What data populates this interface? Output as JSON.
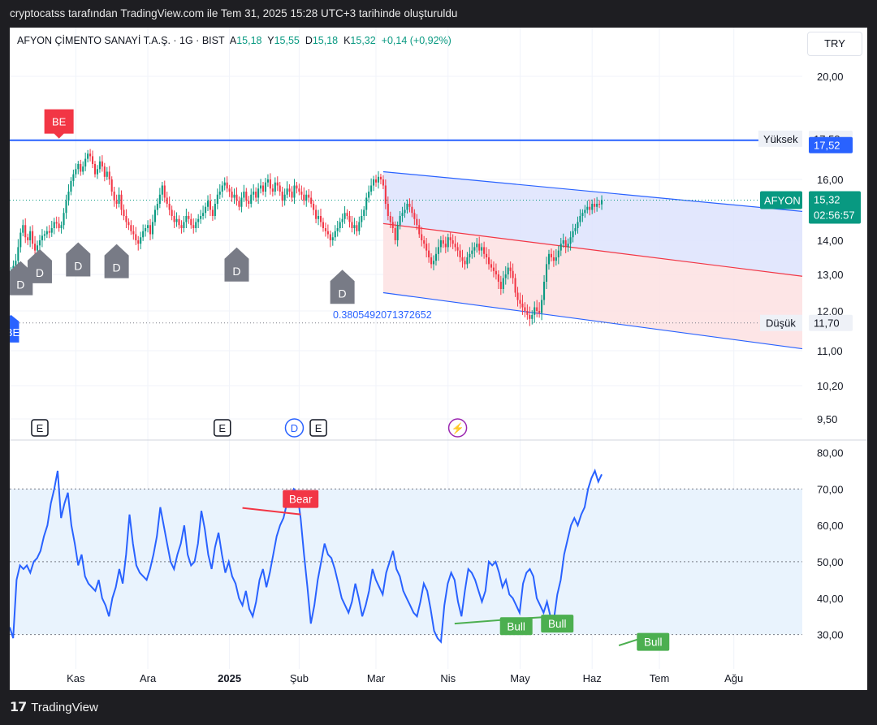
{
  "topbar": {
    "text": "cryptocatss tarafından TradingView.com ile Tem 31, 2025 15:28 UTC+3 tarihinde oluşturuldu"
  },
  "header": {
    "symbol": "AFYON ÇİMENTO SANAYİ T.A.Ş. · 1G · BIST",
    "open_label": "A",
    "open": "15,18",
    "high_label": "Y",
    "high": "15,55",
    "low_label": "D",
    "low": "15,18",
    "close_label": "K",
    "close": "15,32",
    "change": "+0,14 (+0,92%)"
  },
  "currency": "TRY",
  "footer": {
    "brand": "TradingView"
  },
  "colors": {
    "up": "#089981",
    "down": "#f23645",
    "channel_line": "#2962ff",
    "channel_upper_fill": "#dde3fd",
    "channel_lower_fill": "#fde0e2",
    "rsi_line": "#2962ff",
    "rsi_band_fill": "#e9f3fd",
    "bear": "#f23645",
    "bull": "#4caf50",
    "price_label": "#089981",
    "high_line": "#2962ff"
  },
  "chart_data": [
    {
      "type": "candlestick",
      "name": "price",
      "symbol_label": "AFYON",
      "ylim": [
        9.4,
        20.5
      ],
      "y_ticks": [
        "20,00",
        "16,00",
        "14,00",
        "13,00",
        "12,00",
        "11,00",
        "10,20",
        "9,50"
      ],
      "y_tick_values": [
        20,
        16,
        14,
        13,
        12,
        11,
        10.2,
        9.5
      ],
      "x_ticks": [
        "Kas",
        "Ara",
        "2025",
        "Şub",
        "Mar",
        "Nis",
        "May",
        "Haz",
        "Tem",
        "Ağu"
      ],
      "x_tick_index": [
        27,
        57,
        91,
        120,
        152,
        182,
        212,
        242,
        270,
        301
      ],
      "last_price": "15,32",
      "countdown": "02:56:57",
      "high_label": "Yüksek",
      "high_value": "17,58",
      "low_label": "Düşük",
      "low_value": "11,70",
      "horizontal_line": {
        "value": 17.52,
        "label": "17,52"
      },
      "channel_annotation": "0.3805492071372652",
      "channel": {
        "start_index": 155,
        "end_index": 330,
        "upper": [
          16.3,
          14.95
        ],
        "mid": [
          14.55,
          12.95
        ],
        "lower": [
          12.5,
          11.05
        ]
      },
      "closes": [
        13.1,
        13.25,
        13.4,
        13.8,
        14.25,
        14.5,
        14.1,
        14.0,
        14.3,
        13.9,
        13.7,
        13.85,
        14.0,
        14.15,
        14.2,
        14.3,
        14.25,
        14.4,
        14.6,
        14.55,
        14.4,
        14.5,
        14.9,
        15.3,
        15.6,
        15.95,
        16.2,
        16.4,
        16.6,
        16.3,
        16.5,
        16.8,
        17.0,
        16.9,
        16.6,
        16.2,
        16.4,
        16.7,
        16.5,
        16.1,
        16.3,
        16.0,
        15.6,
        15.3,
        15.2,
        15.5,
        15.0,
        14.8,
        14.6,
        14.5,
        14.3,
        14.2,
        14.0,
        13.9,
        14.1,
        14.3,
        14.4,
        14.5,
        14.2,
        14.6,
        15.0,
        15.2,
        15.5,
        15.8,
        15.4,
        15.2,
        15.0,
        14.8,
        14.6,
        14.7,
        14.5,
        14.4,
        14.6,
        14.8,
        14.7,
        14.5,
        14.4,
        14.6,
        14.7,
        14.8,
        14.9,
        15.1,
        15.3,
        15.0,
        14.8,
        15.2,
        15.5,
        15.6,
        15.8,
        15.9,
        15.7,
        15.6,
        15.4,
        15.5,
        15.3,
        15.1,
        15.4,
        15.6,
        15.3,
        15.2,
        15.5,
        15.6,
        15.4,
        15.7,
        15.8,
        15.6,
        15.9,
        16.0,
        15.7,
        15.6,
        15.9,
        15.8,
        15.6,
        15.3,
        15.5,
        15.7,
        15.6,
        15.4,
        15.8,
        15.7,
        15.6,
        15.5,
        15.3,
        15.5,
        15.4,
        15.2,
        15.0,
        14.7,
        14.8,
        14.6,
        14.4,
        14.3,
        14.2,
        14.0,
        14.1,
        14.3,
        14.4,
        14.6,
        14.7,
        14.9,
        14.8,
        14.6,
        14.4,
        14.5,
        14.3,
        14.6,
        14.8,
        15.0,
        15.4,
        15.6,
        15.8,
        16.0,
        15.9,
        16.1,
        16.0,
        15.8,
        15.2,
        14.8,
        14.6,
        14.4,
        14.0,
        14.5,
        14.8,
        14.9,
        15.0,
        15.2,
        15.1,
        14.9,
        14.7,
        14.5,
        14.2,
        14.0,
        13.9,
        13.7,
        13.5,
        13.3,
        13.4,
        13.6,
        13.8,
        14.0,
        13.9,
        13.8,
        14.1,
        14.0,
        13.9,
        13.8,
        13.7,
        13.5,
        13.4,
        13.3,
        13.5,
        13.6,
        13.7,
        13.8,
        13.9,
        13.7,
        13.8,
        13.6,
        13.5,
        13.3,
        13.2,
        13.1,
        13.0,
        12.8,
        12.6,
        12.9,
        13.0,
        13.2,
        13.1,
        12.9,
        12.5,
        12.3,
        12.2,
        12.1,
        12.0,
        11.9,
        11.8,
        11.9,
        12.1,
        12.0,
        11.95,
        12.3,
        12.8,
        13.3,
        13.6,
        13.5,
        13.4,
        13.5,
        13.7,
        13.9,
        14.0,
        13.8,
        13.9,
        14.1,
        14.3,
        14.4,
        14.6,
        14.8,
        14.9,
        15.0,
        15.1,
        15.0,
        15.2,
        15.1,
        15.2,
        15.18,
        15.32
      ],
      "markers": [
        {
          "label": "D",
          "index": 4,
          "price": 13.2
        },
        {
          "label": "D",
          "index": 12,
          "price": 13.55
        },
        {
          "label": "D",
          "index": 28,
          "price": 13.75
        },
        {
          "label": "D",
          "index": 44,
          "price": 13.7
        },
        {
          "label": "D",
          "index": 94,
          "price": 13.6
        },
        {
          "label": "D",
          "index": 138,
          "price": 12.95
        }
      ],
      "flags": [
        {
          "label": "BE",
          "index": 20,
          "price": 17.9,
          "color": "#f23645"
        },
        {
          "label": "BE",
          "index": 0,
          "price": 11.9,
          "color": "#2962ff"
        }
      ],
      "event_badges": [
        {
          "label": "E",
          "index": 12
        },
        {
          "label": "E",
          "index": 88
        },
        {
          "label": "D",
          "index": 118
        },
        {
          "label": "E",
          "index": 128
        },
        {
          "label": "⚡",
          "index": 186
        }
      ]
    },
    {
      "type": "line",
      "name": "rsi",
      "ylim": [
        25,
        83
      ],
      "y_ticks": [
        "80,00",
        "70,00",
        "60,00",
        "50,00",
        "40,00",
        "30,00"
      ],
      "y_tick_values": [
        80,
        70,
        60,
        50,
        40,
        30
      ],
      "band": [
        30,
        70
      ],
      "midline": 50,
      "values": [
        32,
        29,
        45,
        49,
        48,
        49,
        47,
        50,
        51,
        53,
        57,
        60,
        66,
        70,
        75,
        62,
        66,
        69,
        60,
        55,
        49,
        52,
        46,
        44,
        43,
        42,
        45,
        40,
        38,
        35,
        40,
        43,
        48,
        44,
        52,
        63,
        55,
        49,
        47,
        46,
        45,
        48,
        52,
        57,
        65,
        60,
        55,
        50,
        48,
        52,
        55,
        60,
        52,
        49,
        50,
        55,
        64,
        59,
        52,
        48,
        54,
        58,
        52,
        47,
        50,
        46,
        44,
        40,
        38,
        42,
        37,
        35,
        39,
        45,
        48,
        43,
        47,
        52,
        57,
        60,
        62,
        66,
        68,
        70,
        69,
        62,
        52,
        43,
        33,
        38,
        45,
        50,
        55,
        52,
        51,
        48,
        44,
        40,
        38,
        36,
        39,
        44,
        40,
        35,
        38,
        42,
        48,
        45,
        43,
        41,
        47,
        50,
        53,
        48,
        46,
        42,
        40,
        38,
        36,
        35,
        39,
        44,
        42,
        37,
        31,
        29,
        28,
        38,
        44,
        47,
        45,
        39,
        35,
        42,
        48,
        47,
        45,
        42,
        39,
        42,
        50,
        49,
        50,
        47,
        43,
        45,
        41,
        40,
        38,
        36,
        44,
        47,
        48,
        46,
        40,
        38,
        36,
        39,
        35,
        34,
        41,
        45,
        52,
        56,
        60,
        62,
        60,
        63,
        65,
        70,
        73,
        75,
        72,
        74
      ]
    }
  ],
  "annotations": {
    "bear": {
      "label": "Bear",
      "from": [
        68,
        64.8
      ],
      "to": [
        85,
        63
      ]
    },
    "bull": [
      {
        "label": "Bull",
        "from": [
          130,
          33
        ],
        "to": [
          148,
          34.3
        ]
      },
      {
        "label": "Bull",
        "from": [
          148,
          34.3
        ],
        "to": [
          160,
          35
        ]
      },
      {
        "label": "Bull",
        "from": [
          178,
          27
        ],
        "to": [
          188,
          30
        ]
      }
    ]
  }
}
